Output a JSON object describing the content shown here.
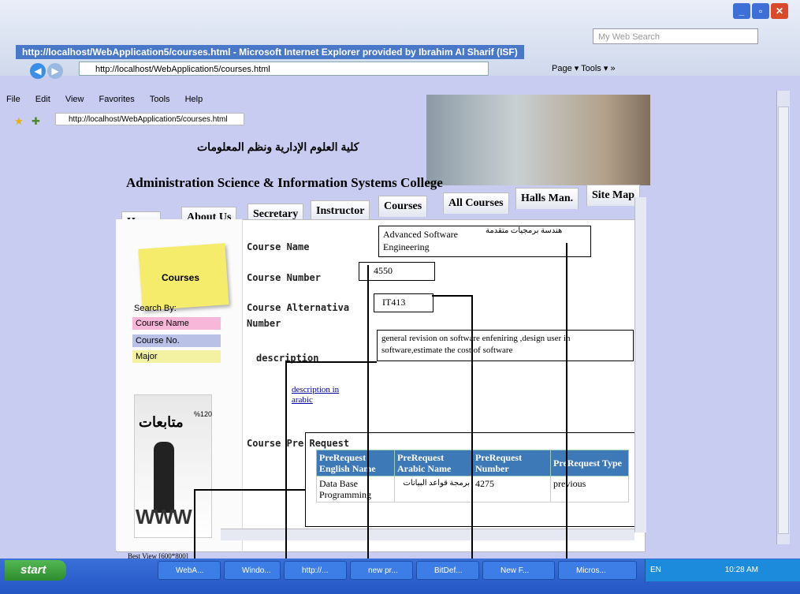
{
  "window": {
    "title": "http://localhost/WebApplication5/courses.html - Microsoft Internet Explorer provided by Ibrahim Al Sharif (ISF)",
    "address_top": "http://localhost/WebApplication5/courses.html",
    "address_fav": "http://localhost/WebApplication5/courses.html",
    "search_placeholder": "My Web Search",
    "btn_min": "_",
    "btn_max": "▫",
    "btn_close": "✕",
    "commands": "Page ▾   Tools ▾   »",
    "menu": [
      "File",
      "Edit",
      "View",
      "Favorites",
      "Tools",
      "Help"
    ]
  },
  "site": {
    "arabic_title": "كلية العلوم الإدارية ونظم المعلومات",
    "english_title": "Administration Science & Information Systems College",
    "tabs": [
      "Home",
      "About Us",
      "Secretary",
      "Instructor",
      "Courses",
      "All Courses",
      "Halls Man.",
      "Site Map"
    ]
  },
  "sidebar": {
    "sticky_label": "Courses",
    "search_by": "Search By:",
    "options": [
      "Course Name",
      "Course No.",
      "Major"
    ],
    "follow_pct": "%120",
    "follow_title": "متابعات",
    "www": "WWW",
    "best_view": "Best View [600*800]"
  },
  "form": {
    "course_name_label": "Course Name",
    "course_name_value": "Advanced Software Engineering",
    "course_name_arabic": "هندسة برمجيات متقدمة",
    "course_number_label": "Course Number",
    "course_number_value": "4550",
    "course_alt_label": "Course Alternativa Number",
    "course_alt_value": "IT413",
    "description_label": "description",
    "description_value": "general revision on software enfeniring ,design user in software,estimate the cost of software",
    "desc_arabic_link": "description in arabic",
    "prereq_label": "Course Pre Request"
  },
  "prereq_table": {
    "headers": [
      "PreRequest English Name",
      "PreRequest Arabic Name",
      "PreRequest Number",
      "PreRequest Type"
    ],
    "rows": [
      [
        "Data Base Programming",
        "برمجة قواعد البيانات",
        "4275",
        "previous"
      ]
    ]
  },
  "taskbar": {
    "start": "start",
    "tasks": [
      "WebA...",
      "Windo...",
      "http://...",
      "new pr...",
      "BitDef...",
      "New F...",
      "Micros..."
    ],
    "lang": "EN",
    "clock": "10:28 AM"
  }
}
